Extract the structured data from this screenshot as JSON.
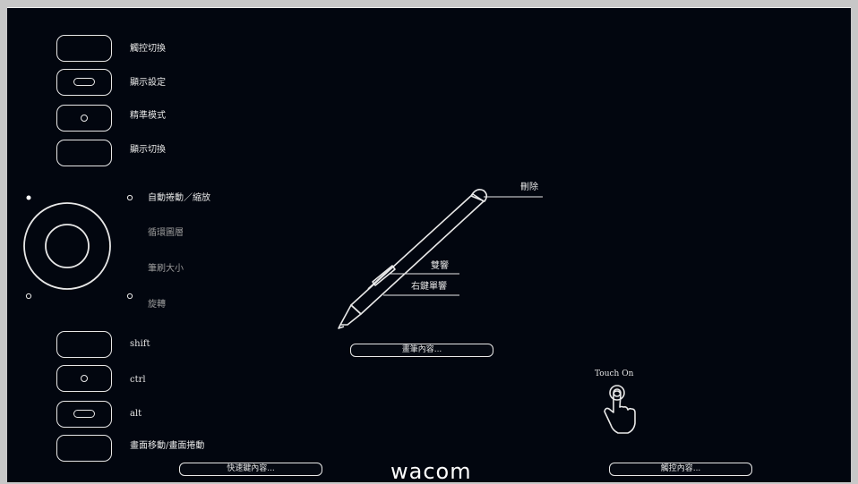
{
  "express_keys": {
    "top": [
      {
        "label": "觸控切換"
      },
      {
        "label": "顯示設定"
      },
      {
        "label": "精準模式"
      },
      {
        "label": "顯示切換"
      }
    ],
    "bottom": [
      {
        "label": "shift"
      },
      {
        "label": "ctrl"
      },
      {
        "label": "alt"
      },
      {
        "label": "畫面移動/畫面捲動"
      }
    ]
  },
  "touch_ring": {
    "modes": [
      {
        "label": "自動捲動／縮放"
      },
      {
        "label": "循環圖層"
      },
      {
        "label": "筆刷大小"
      },
      {
        "label": "旋轉"
      }
    ]
  },
  "pen": {
    "eraser_label": "刪除",
    "upper_switch_label": "雙響",
    "lower_switch_label": "右鍵單響"
  },
  "buttons": {
    "pen_settings": "畫筆內容...",
    "express_settings": "快速鍵內容...",
    "touch_settings": "觸控內容..."
  },
  "touch": {
    "status": "Touch On"
  },
  "brand": {
    "logo": "wacom"
  }
}
